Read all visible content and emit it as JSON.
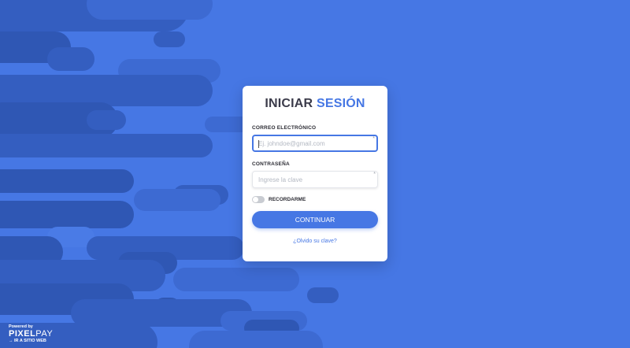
{
  "login": {
    "title_main": "INICIAR",
    "title_accent": "SESIÓN",
    "email_label": "CORREO ELECTRÓNICO",
    "email_placeholder": "Ej. johndoe@gmail.com",
    "password_label": "CONTRASEÑA",
    "password_placeholder": "Ingrese la clave",
    "required_marker": "*",
    "remember_label": "RECORDARME",
    "remember_on": false,
    "submit_label": "CONTINUAR",
    "forgot_label": "¿Olvido su clave?"
  },
  "branding": {
    "powered_by": "Powered by",
    "logo_pixel": "PIXEL",
    "logo_pay": "PAY",
    "site_link": "→ IR A SITIO WEB"
  },
  "colors": {
    "accent": "#4677e4",
    "background": "#4677e4",
    "card": "#ffffff"
  }
}
